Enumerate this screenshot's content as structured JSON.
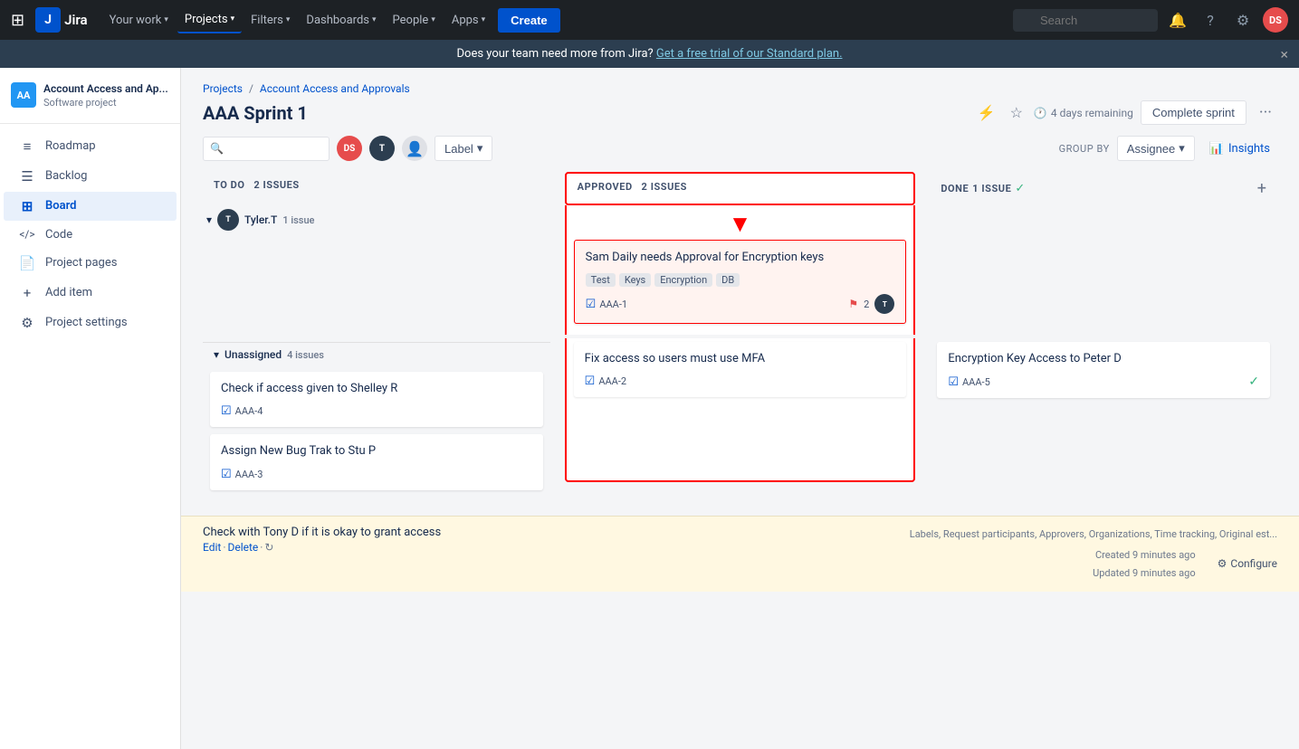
{
  "topnav": {
    "logo_text": "Jira",
    "your_work": "Your work",
    "projects": "Projects",
    "filters": "Filters",
    "dashboards": "Dashboards",
    "people": "People",
    "apps": "Apps",
    "create": "Create",
    "search_placeholder": "Search"
  },
  "banner": {
    "text": "Does your team need more from Jira?",
    "link_text": "Get a free trial of our Standard plan.",
    "close": "×"
  },
  "sidebar": {
    "project_name": "Account Access and Ap...",
    "project_type": "Software project",
    "items": [
      {
        "id": "roadmap",
        "label": "Roadmap",
        "icon": "≡"
      },
      {
        "id": "backlog",
        "label": "Backlog",
        "icon": "☰"
      },
      {
        "id": "board",
        "label": "Board",
        "icon": "⊞",
        "active": true
      },
      {
        "id": "code",
        "label": "Code",
        "icon": "<>"
      },
      {
        "id": "project-pages",
        "label": "Project pages",
        "icon": "📄"
      },
      {
        "id": "add-item",
        "label": "Add item",
        "icon": "+"
      },
      {
        "id": "project-settings",
        "label": "Project settings",
        "icon": "⚙"
      }
    ]
  },
  "breadcrumb": {
    "projects": "Projects",
    "project": "Account Access and Approvals"
  },
  "sprint": {
    "title": "AAA Sprint 1",
    "days_remaining": "4 days remaining",
    "complete_button": "Complete sprint",
    "more": "..."
  },
  "board_toolbar": {
    "label_btn": "Label",
    "groupby_label": "GROUP BY",
    "assignee_btn": "Assignee",
    "insights_btn": "Insights"
  },
  "columns": {
    "todo": {
      "title": "TO DO",
      "issue_count": "2 ISSUES"
    },
    "approved": {
      "title": "APPROVED",
      "issue_count": "2 ISSUES"
    },
    "done": {
      "title": "DONE",
      "issue_count": "1 ISSUE",
      "check": "✓"
    }
  },
  "tyler_group": {
    "name": "Tyler.T",
    "count": "1 issue",
    "initials": "T"
  },
  "approved_card": {
    "title": "Sam Daily needs Approval for Encryption keys",
    "tags": [
      "Test",
      "Keys",
      "Encryption",
      "DB"
    ],
    "id": "AAA-1",
    "flag_count": "2",
    "assignee_initials": "T"
  },
  "unassigned_group": {
    "label": "Unassigned",
    "count": "4 issues"
  },
  "todo_cards": [
    {
      "title": "Check if access given to Shelley R",
      "id": "AAA-4"
    },
    {
      "title": "Assign New Bug Trak to Stu P",
      "id": "AAA-3"
    }
  ],
  "approved_cards_unassigned": [
    {
      "title": "Fix access so users must use MFA",
      "id": "AAA-2"
    }
  ],
  "done_cards": [
    {
      "title": "Encryption Key Access to Peter D",
      "id": "AAA-5",
      "check": "✓"
    }
  ],
  "bottom_task": {
    "title": "Check with Tony D if it is okay to grant access",
    "edit": "Edit",
    "delete": "Delete",
    "icon": "↻"
  },
  "bottom_meta": {
    "labels": "Labels, Request participants, Approvers, Organizations, Time tracking, Original est...",
    "created": "Created 9 minutes ago",
    "updated": "Updated 9 minutes ago",
    "configure": "Configure"
  }
}
